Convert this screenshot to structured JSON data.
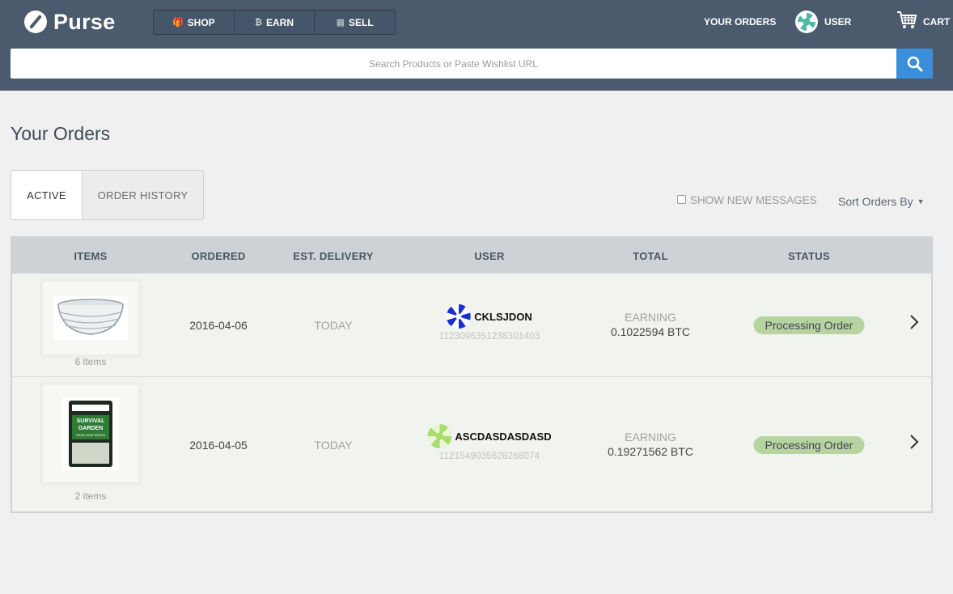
{
  "header": {
    "brand": "Purse",
    "nav": [
      {
        "label": "SHOP",
        "icon": "gift-icon",
        "glyph": "🎁"
      },
      {
        "label": "EARN",
        "icon": "bitcoin-icon",
        "glyph": "₿"
      },
      {
        "label": "SELL",
        "icon": "calculator-icon",
        "glyph": "▦"
      }
    ],
    "your_orders": "YOUR ORDERS",
    "user_label": "USER",
    "cart_label": "CART"
  },
  "search": {
    "placeholder": "Search Products or Paste Wishlist URL",
    "value": ""
  },
  "page": {
    "title": "Your Orders",
    "tabs": {
      "active": "ACTIVE",
      "history": "ORDER HISTORY"
    },
    "show_new_messages": "SHOW NEW MESSAGES",
    "sort_label": "Sort Orders By"
  },
  "table": {
    "headers": {
      "items": "ITEMS",
      "ordered": "ORDERED",
      "delivery": "EST. DELIVERY",
      "user": "USER",
      "total": "TOTAL",
      "status": "STATUS"
    },
    "rows": [
      {
        "item_count": "6 items",
        "ordered": "2016-04-06",
        "delivery": "TODAY",
        "user_name": "CKLSJDON",
        "user_id": "1123096351238301403",
        "total_label": "EARNING",
        "total_amount": "0.1022594 BTC",
        "status": "Processing Order"
      },
      {
        "item_count": "2 items",
        "ordered": "2016-04-05",
        "delivery": "TODAY",
        "user_name": "ASCDASDASDASD",
        "user_id": "1121549035628268074",
        "total_label": "EARNING",
        "total_amount": "0.19271562 BTC",
        "status": "Processing Order"
      }
    ]
  },
  "colors": {
    "header_bg": "#4b5b6d",
    "search_button": "#3a8fd8",
    "status_badge": "#b7d3a0"
  }
}
